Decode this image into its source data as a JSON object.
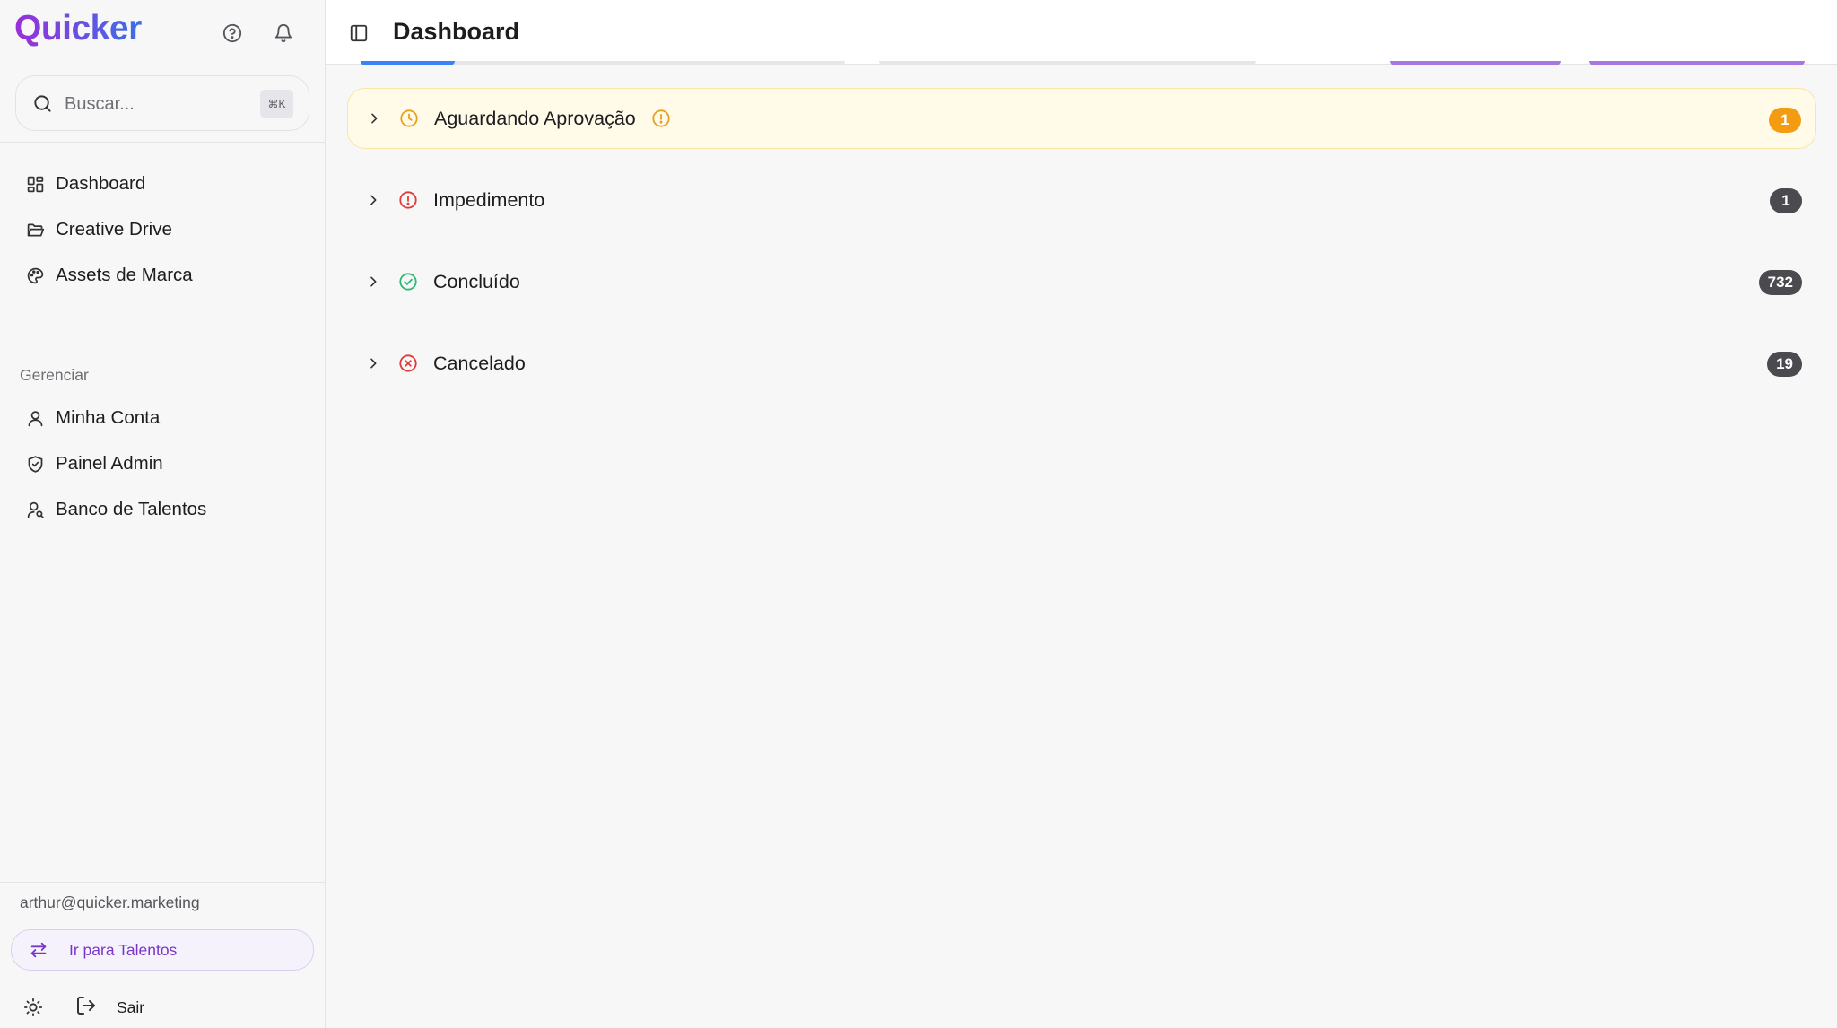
{
  "app": {
    "logo_text": "Quicker",
    "brand_gradient": [
      "#9b2fd8",
      "#3b6fe6"
    ]
  },
  "search": {
    "placeholder": "Buscar...",
    "shortcut": "⌘K"
  },
  "sidebar": {
    "nav": [
      {
        "label": "Dashboard",
        "icon": "layout-dashboard-icon"
      },
      {
        "label": "Creative Drive",
        "icon": "folder-open-icon"
      },
      {
        "label": "Assets de Marca",
        "icon": "palette-icon"
      }
    ],
    "section_label": "Gerenciar",
    "manage": [
      {
        "label": "Minha Conta",
        "icon": "user-icon"
      },
      {
        "label": "Painel Admin",
        "icon": "shield-check-icon"
      },
      {
        "label": "Banco de Talentos",
        "icon": "user-search-icon"
      }
    ],
    "user_email": "arthur@quicker.marketing",
    "switch_button_label": "Ir para Talentos",
    "logout_label": "Sair"
  },
  "header": {
    "title": "Dashboard"
  },
  "status_groups": [
    {
      "label": "Aguardando Aprovação",
      "count": "1",
      "status_color": "#e8a020",
      "badge_color": "#f39c12",
      "highlighted": true,
      "icon": "clock-icon"
    },
    {
      "label": "Impedimento",
      "count": "1",
      "status_color": "#e03b3b",
      "badge_color": "#4a4a4f",
      "highlighted": false,
      "icon": "alert-circle-icon"
    },
    {
      "label": "Concluído",
      "count": "732",
      "status_color": "#2eb872",
      "badge_color": "#4a4a4f",
      "highlighted": false,
      "icon": "check-circle-icon"
    },
    {
      "label": "Cancelado",
      "count": "19",
      "status_color": "#e03b3b",
      "badge_color": "#4a4a4f",
      "highlighted": false,
      "icon": "x-circle-icon"
    }
  ]
}
